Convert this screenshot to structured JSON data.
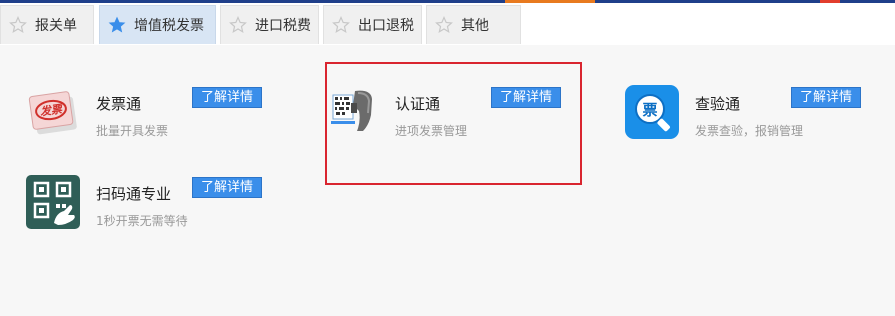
{
  "tabs": [
    {
      "label": "报关单",
      "active": false
    },
    {
      "label": "增值税发票",
      "active": true
    },
    {
      "label": "进口税费",
      "active": false
    },
    {
      "label": "出口退税",
      "active": false
    },
    {
      "label": "其他",
      "active": false
    }
  ],
  "apps": [
    {
      "name": "发票通",
      "desc": "批量开具发票",
      "button": "了解详情",
      "icon": "invoice-stamp-icon",
      "icon_text": "发票"
    },
    {
      "name": "认证通",
      "desc": "进项发票管理",
      "button": "了解详情",
      "icon": "barcode-scanner-icon"
    },
    {
      "name": "查验通",
      "desc": "发票查验，报销管理",
      "button": "了解详情",
      "icon": "invoice-search-icon",
      "icon_text": "票"
    },
    {
      "name": "扫码通专业",
      "desc": "1秒开票无需等待",
      "button": "了解详情",
      "icon": "qr-code-icon"
    }
  ],
  "colors": {
    "accent": "#3a8eea",
    "active_tab": "#d8e5f4",
    "highlight": "#d9252f",
    "star_active": "#3a8eea",
    "star_inactive": "#c8c8c8"
  }
}
